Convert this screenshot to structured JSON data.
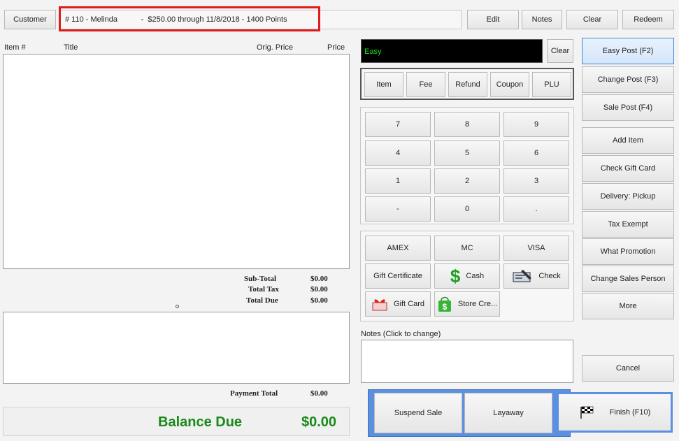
{
  "header": {
    "customer_btn": "Customer",
    "customer_info": "# 110 - Melinda           -  $250.00 through 11/8/2018 - 1400 Points",
    "edit_btn": "Edit",
    "notes_btn": "Notes",
    "clear_btn": "Clear",
    "redeem_btn": "Redeem",
    "highlight_color": "#e01b1b"
  },
  "items_table": {
    "columns": [
      "Item #",
      "Title",
      "Orig. Price",
      "Price"
    ]
  },
  "totals": {
    "subtotal_label": "Sub-Total",
    "subtotal_value": "$0.00",
    "tax_label": "Total Tax",
    "tax_value": "$0.00",
    "due_label": "Total Due",
    "due_value": "$0.00",
    "payment_label": "Payment Total",
    "payment_value": "$0.00",
    "balance_label": "Balance Due",
    "balance_value": "$0.00",
    "balance_color": "#1a8a1a"
  },
  "entry": {
    "display_text": "Easy",
    "display_text_color": "#22dd22",
    "clear_btn": "Clear"
  },
  "item_types": [
    "Item",
    "Fee",
    "Refund",
    "Coupon",
    "PLU"
  ],
  "keypad": [
    "7",
    "8",
    "9",
    "4",
    "5",
    "6",
    "1",
    "2",
    "3",
    "-",
    "0",
    "."
  ],
  "tenders": {
    "amex": "AMEX",
    "mc": "MC",
    "visa": "VISA",
    "gift_certificate": "Gift Certificate",
    "cash": "Cash",
    "check": "Check",
    "gift_card": "Gift Card",
    "store_credit": "Store Cre..."
  },
  "notes": {
    "label": "Notes (Click to change)"
  },
  "actions": {
    "suspend": "Suspend Sale",
    "layaway": "Layaway",
    "finish": "Finish (F10)",
    "frame_color": "#5b8fe0"
  },
  "right_panel": {
    "easy_post": "Easy Post (F2)",
    "change_post": "Change Post (F3)",
    "sale_post": "Sale Post (F4)",
    "add_item": "Add Item",
    "check_gift_card": "Check Gift Card",
    "delivery": "Delivery: Pickup",
    "tax_exempt": "Tax Exempt",
    "what_promotion": "What Promotion",
    "change_sales_person": "Change Sales Person",
    "more": "More",
    "cancel": "Cancel"
  }
}
